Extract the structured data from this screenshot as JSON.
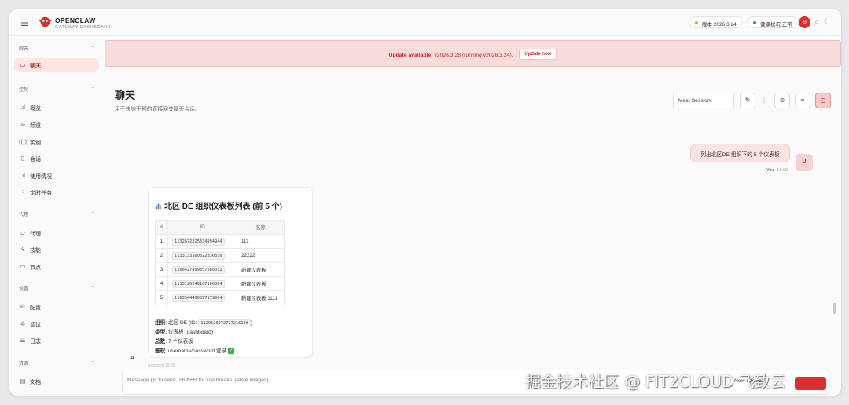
{
  "brand": {
    "name": "OPENCLAW",
    "subtitle": "GATEWAY DASHBOARD"
  },
  "topbar": {
    "version_label": "版本 2026.3.24",
    "health_label": "健康状况 正常",
    "health_color": "#2e9e44",
    "version_color": "#f0a020"
  },
  "sidebar": {
    "sections": [
      {
        "title": "聊天",
        "items": [
          {
            "label": "聊天",
            "icon": "chat-bubble-icon",
            "active": true
          }
        ]
      },
      {
        "title": "控制",
        "items": [
          {
            "label": "概览",
            "icon": "bar-chart-icon"
          },
          {
            "label": "频道",
            "icon": "link-icon"
          },
          {
            "label": "实例",
            "icon": "broadcast-icon"
          },
          {
            "label": "会话",
            "icon": "document-icon"
          },
          {
            "label": "使用情况",
            "icon": "bar-chart-icon"
          },
          {
            "label": "定时任务",
            "icon": "spinner-icon"
          }
        ]
      },
      {
        "title": "代理",
        "items": [
          {
            "label": "代理",
            "icon": "folder-icon"
          },
          {
            "label": "技能",
            "icon": "lightning-icon"
          },
          {
            "label": "节点",
            "icon": "monitor-icon"
          }
        ]
      },
      {
        "title": "设置",
        "items": [
          {
            "label": "配置",
            "icon": "gear-icon"
          },
          {
            "label": "调试",
            "icon": "bug-icon"
          },
          {
            "label": "日志",
            "icon": "log-icon"
          }
        ]
      },
      {
        "title": "资源",
        "items": [
          {
            "label": "文档",
            "icon": "book-icon"
          }
        ]
      }
    ]
  },
  "banner": {
    "lead": "Update available:",
    "text": " v2026.3.28 (running v2026.3.24).",
    "button": "Update now"
  },
  "page": {
    "title": "聊天",
    "subtitle": "用于快速干预的直接网关聊天会话。",
    "session": "Main Session"
  },
  "chat": {
    "user_message": "列出北区DE 组织下的 5 个仪表板",
    "user_avatar": "U",
    "user_name": "You",
    "user_time": "16:09",
    "assistant_avatar": "A",
    "assistant_meta": "Assistant 16:09",
    "card": {
      "title": "北区 DE 组织仪表板列表 (前 5 个)",
      "columns": [
        "#",
        "ID",
        "名称"
      ],
      "rows": [
        {
          "n": "1",
          "id": "1132672325334994944",
          "name": "111"
        },
        {
          "n": "2",
          "id": "1133133160322830336",
          "name": "22222"
        },
        {
          "n": "3",
          "id": "1166427499857580032",
          "name": "新建仪表板"
        },
        {
          "n": "4",
          "id": "1133126240107106304",
          "name": "新建仪表板"
        },
        {
          "n": "5",
          "id": "1163544460317179904",
          "name": "新建仪表板 1111"
        }
      ],
      "org_label": "组织",
      "org_value": ": 北区 DE (ID: ",
      "org_id": "1129520272727216128",
      "org_tail": ")",
      "type_label": "类型",
      "type_value": ": 仪表板 (dashboard)",
      "total_label": "总数",
      "total_value": ": 7 个仪表板",
      "auth_label": "鉴权",
      "auth_value": ": username/password 登录",
      "auth_check": "✓"
    }
  },
  "composer": {
    "placeholder": "Message (↩ to send, Shift+↩ for line breaks, paste images)",
    "new_session": "New session"
  },
  "watermark": "掘金技术社区 @ FIT2CLOUD 飞致云"
}
